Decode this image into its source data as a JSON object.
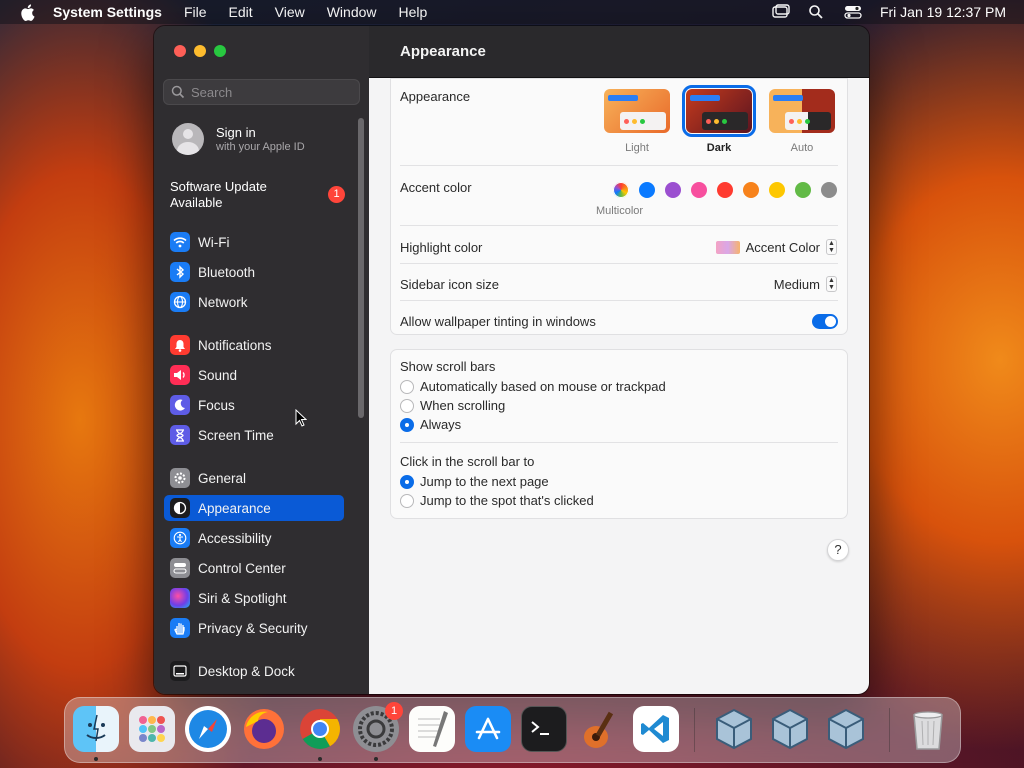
{
  "menubar": {
    "app_name": "System Settings",
    "items": [
      "File",
      "Edit",
      "View",
      "Window",
      "Help"
    ],
    "clock": "Fri Jan 19  12:37 PM"
  },
  "window": {
    "title": "Appearance"
  },
  "sidebar": {
    "search_placeholder": "Search",
    "signin_title": "Sign in",
    "signin_subtitle": "with your Apple ID",
    "update_label": "Software Update Available",
    "update_badge": "1",
    "items": [
      {
        "label": "Wi-Fi",
        "icon": "wifi-icon",
        "color": "#1a7cf5"
      },
      {
        "label": "Bluetooth",
        "icon": "bluetooth-icon",
        "color": "#1a7cf5"
      },
      {
        "label": "Network",
        "icon": "globe-icon",
        "color": "#1a7cf5"
      },
      {
        "label": "Notifications",
        "icon": "bell-icon",
        "color": "#ff3b30"
      },
      {
        "label": "Sound",
        "icon": "speaker-icon",
        "color": "#ff2d55"
      },
      {
        "label": "Focus",
        "icon": "moon-icon",
        "color": "#5e5ce6"
      },
      {
        "label": "Screen Time",
        "icon": "hourglass-icon",
        "color": "#5e5ce6"
      },
      {
        "label": "General",
        "icon": "gear-icon",
        "color": "#8e8e93"
      },
      {
        "label": "Appearance",
        "icon": "appearance-icon",
        "color": "#1c1c1e"
      },
      {
        "label": "Accessibility",
        "icon": "accessibility-icon",
        "color": "#1a7cf5"
      },
      {
        "label": "Control Center",
        "icon": "control-center-icon",
        "color": "#8e8e93"
      },
      {
        "label": "Siri & Spotlight",
        "icon": "siri-icon",
        "color": "#a04ce0"
      },
      {
        "label": "Privacy & Security",
        "icon": "hand-icon",
        "color": "#1a7cf5"
      },
      {
        "label": "Desktop & Dock",
        "icon": "dock-icon",
        "color": "#1c1c1e"
      }
    ],
    "selected": "Appearance"
  },
  "appearance": {
    "label": "Appearance",
    "themes": [
      {
        "label": "Light",
        "selected": false
      },
      {
        "label": "Dark",
        "selected": true
      },
      {
        "label": "Auto",
        "selected": false
      }
    ],
    "accent_label": "Accent color",
    "accent_selected_label": "Multicolor",
    "accent_colors": [
      "multicolor",
      "#0a7aff",
      "#9b4fd0",
      "#f74f9e",
      "#ff3b30",
      "#f7821b",
      "#fdc701",
      "#62ba46",
      "#8c8c8c"
    ],
    "highlight_label": "Highlight color",
    "highlight_value": "Accent Color",
    "icon_size_label": "Sidebar icon size",
    "icon_size_value": "Medium",
    "tinting_label": "Allow wallpaper tinting in windows",
    "tinting_on": true
  },
  "scrollbars": {
    "show_label": "Show scroll bars",
    "show_options": [
      {
        "label": "Automatically based on mouse or trackpad",
        "selected": false
      },
      {
        "label": "When scrolling",
        "selected": false
      },
      {
        "label": "Always",
        "selected": true
      }
    ],
    "click_label": "Click in the scroll bar to",
    "click_options": [
      {
        "label": "Jump to the next page",
        "selected": true
      },
      {
        "label": "Jump to the spot that's clicked",
        "selected": false
      }
    ]
  },
  "help_label": "?",
  "dock": {
    "apps": [
      "finder-icon",
      "launchpad-icon",
      "safari-icon",
      "firefox-icon",
      "chrome-icon",
      "system-settings-icon",
      "textedit-icon",
      "app-store-icon",
      "terminal-icon",
      "garageband-icon",
      "vscode-icon",
      "virtualbox-icon",
      "virtualbox-icon",
      "virtualbox-icon",
      "trash-icon"
    ],
    "settings_badge": "1"
  }
}
